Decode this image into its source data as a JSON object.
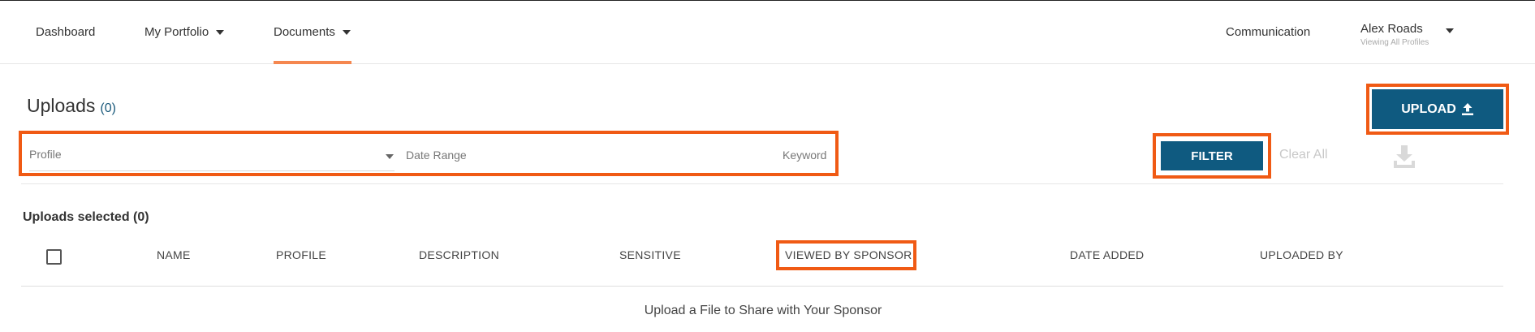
{
  "nav": {
    "dashboard": "Dashboard",
    "portfolio": "My Portfolio",
    "documents": "Documents",
    "communication": "Communication",
    "user_name": "Alex Roads",
    "user_sub": "Viewing All Profiles"
  },
  "page": {
    "title": "Uploads",
    "count": "(0)"
  },
  "actions": {
    "upload_label": "UPLOAD",
    "filter_label": "FILTER",
    "clear_label": "Clear All"
  },
  "filters": {
    "profile": "Profile",
    "date_range": "Date Range",
    "keyword": "Keyword"
  },
  "table": {
    "selected_label": "Uploads selected (0)",
    "columns": [
      "NAME",
      "PROFILE",
      "DESCRIPTION",
      "SENSITIVE",
      "VIEWED BY SPONSOR",
      "DATE ADDED",
      "UPLOADED BY"
    ],
    "empty_message": "Upload a File to Share with Your Sponsor"
  },
  "colors": {
    "accent": "#f5874f",
    "primary": "#0f5a80",
    "highlight": "#f05a14"
  },
  "icons": {
    "upload": "upload-icon",
    "download": "download-icon",
    "caret": "caret-down-icon"
  }
}
